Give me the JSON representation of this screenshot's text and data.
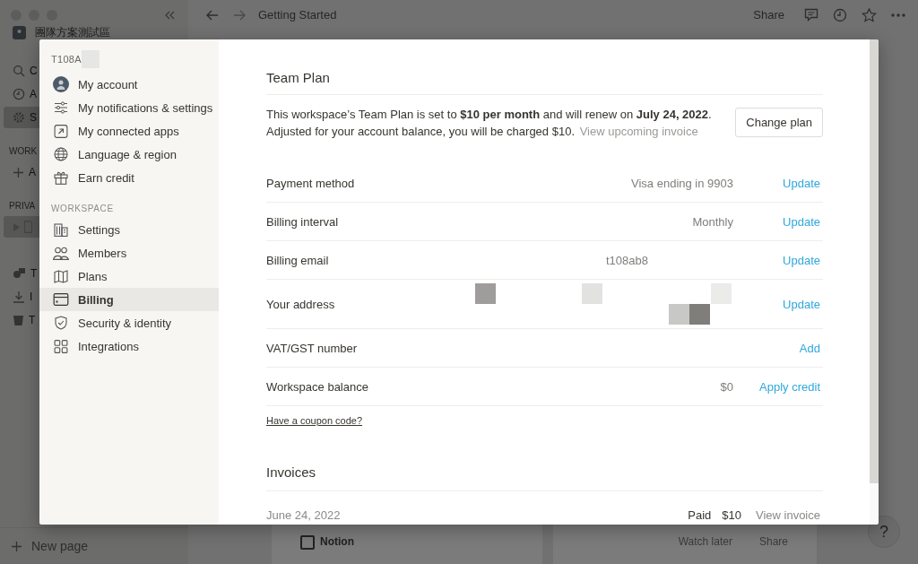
{
  "sidebar": {
    "workspace_name": "團隊方案測試區",
    "items": [
      {
        "label": "C",
        "kind": "search",
        "selected": false
      },
      {
        "label": "A",
        "kind": "updates",
        "selected": false
      },
      {
        "label": "S",
        "kind": "settings",
        "selected": true
      }
    ],
    "sections": [
      {
        "title": "WORK",
        "items": [
          {
            "label": "A",
            "kind": "add",
            "selected": false
          }
        ]
      },
      {
        "title": "PRIVA",
        "items": [
          {
            "kind": "page",
            "selected": true
          }
        ]
      }
    ],
    "tools": [
      {
        "label": "T",
        "kind": "templates"
      },
      {
        "label": "I",
        "kind": "import"
      },
      {
        "label": "T",
        "kind": "trash"
      }
    ],
    "new_page": "New page"
  },
  "topbar": {
    "title": "Getting Started",
    "share": "Share"
  },
  "page_behind": {
    "card_title": "Notion",
    "video_actions": [
      "Watch later",
      "Share"
    ],
    "help": "?"
  },
  "settings": {
    "account_label": "T108A",
    "account_items": [
      {
        "label": "My account",
        "kind": "avatar",
        "selected": false
      },
      {
        "label": "My notifications & settings",
        "kind": "sliders",
        "selected": false
      },
      {
        "label": "My connected apps",
        "kind": "arrow-box",
        "selected": false
      },
      {
        "label": "Language & region",
        "kind": "globe",
        "selected": false
      },
      {
        "label": "Earn credit",
        "kind": "gift",
        "selected": false
      }
    ],
    "workspace_heading": "WORKSPACE",
    "workspace_items": [
      {
        "label": "Settings",
        "kind": "building",
        "selected": false
      },
      {
        "label": "Members",
        "kind": "people",
        "selected": false
      },
      {
        "label": "Plans",
        "kind": "map",
        "selected": false
      },
      {
        "label": "Billing",
        "kind": "card",
        "selected": true
      },
      {
        "label": "Security & identity",
        "kind": "shield",
        "selected": false
      },
      {
        "label": "Integrations",
        "kind": "grid",
        "selected": false
      }
    ]
  },
  "billing": {
    "heading": "Team Plan",
    "plan_text": "This workspace’s Team Plan is set to **$10 per month** and will renew on **July 24, 2022**.",
    "balance_note": "Adjusted for your account balance, you will be charged $10.",
    "upcoming_link": "View upcoming invoice",
    "change_plan": "Change plan",
    "rows": [
      {
        "label": "Payment method",
        "kind": "text",
        "value": "Visa ending in 9903",
        "action": "Update"
      },
      {
        "label": "Billing interval",
        "kind": "text",
        "value": "Monthly",
        "action": "Update"
      },
      {
        "label": "Billing email",
        "kind": "email",
        "value": "t108ab8",
        "action": "Update"
      },
      {
        "label": "Your address",
        "kind": "redacted",
        "action": "Update"
      },
      {
        "label": "VAT/GST number",
        "kind": "text",
        "action": "Add"
      },
      {
        "label": "Workspace balance",
        "kind": "text",
        "value": "$0",
        "action": "Apply credit"
      }
    ],
    "coupon": "Have a coupon code?",
    "invoices_heading": "Invoices",
    "invoices": [
      {
        "date": "June 24, 2022",
        "status": "Paid",
        "amount": "$10",
        "action": "View invoice"
      }
    ]
  }
}
